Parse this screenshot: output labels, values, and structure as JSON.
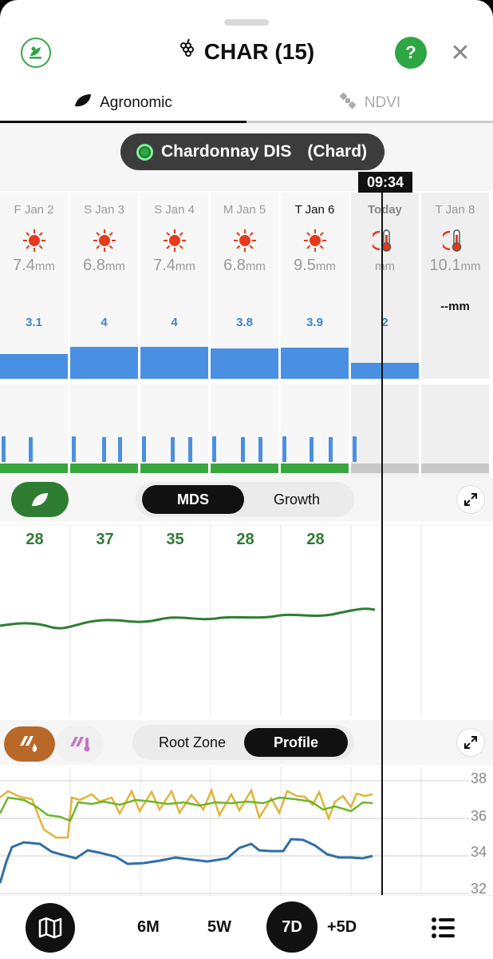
{
  "header": {
    "title": "CHAR (15)",
    "help": "?",
    "close": "✕"
  },
  "tabs": [
    {
      "label": "Agronomic",
      "active": true
    },
    {
      "label": "NDVI",
      "active": false
    }
  ],
  "zone_pill": {
    "label": "Chardonnay DIS",
    "sub": "(Chard)"
  },
  "time_flag": "09:34",
  "days": [
    {
      "label": "F Jan 2",
      "rain_value": "7.4",
      "rain_unit": "mm",
      "et": "3.1",
      "weather": "sun-icon"
    },
    {
      "label": "S Jan 3",
      "rain_value": "6.8",
      "rain_unit": "mm",
      "et": "4",
      "weather": "sun-icon"
    },
    {
      "label": "S Jan 4",
      "rain_value": "7.4",
      "rain_unit": "mm",
      "et": "4",
      "weather": "sun-icon"
    },
    {
      "label": "M Jan 5",
      "rain_value": "6.8",
      "rain_unit": "mm",
      "et": "3.8",
      "weather": "sun-icon"
    },
    {
      "label": "T Jan 6",
      "rain_value": "9.5",
      "rain_unit": "mm",
      "et": "3.9",
      "weather": "sun-icon"
    },
    {
      "label": "Today",
      "rain_value": "",
      "rain_unit": "mm",
      "et": "2",
      "weather": "hot-thermometer-icon"
    },
    {
      "label": "T Jan 8",
      "rain_value": "10.1",
      "rain_unit": "mm",
      "et": "--mm",
      "weather": "hot-thermometer-icon"
    }
  ],
  "mds_controls": {
    "option1": "MDS",
    "option2": "Growth",
    "selected": "MDS"
  },
  "mds_values": [
    "28",
    "37",
    "35",
    "28",
    "28"
  ],
  "soil_controls": {
    "option1": "Root Zone",
    "option2": "Profile",
    "selected": "Profile"
  },
  "soil_axis": [
    "38",
    "36",
    "34",
    "32"
  ],
  "bottom_bar": {
    "ranges": [
      "6M",
      "5W",
      "7D",
      "+5D"
    ],
    "selected": "7D"
  },
  "colors": {
    "accent_green": "#2ea643",
    "et_blue": "#4a90e2",
    "soil_brown": "#b8692a",
    "line_yellow": "#e0b53a",
    "line_green": "#6fb52c",
    "line_blue": "#2f6fa8"
  }
}
